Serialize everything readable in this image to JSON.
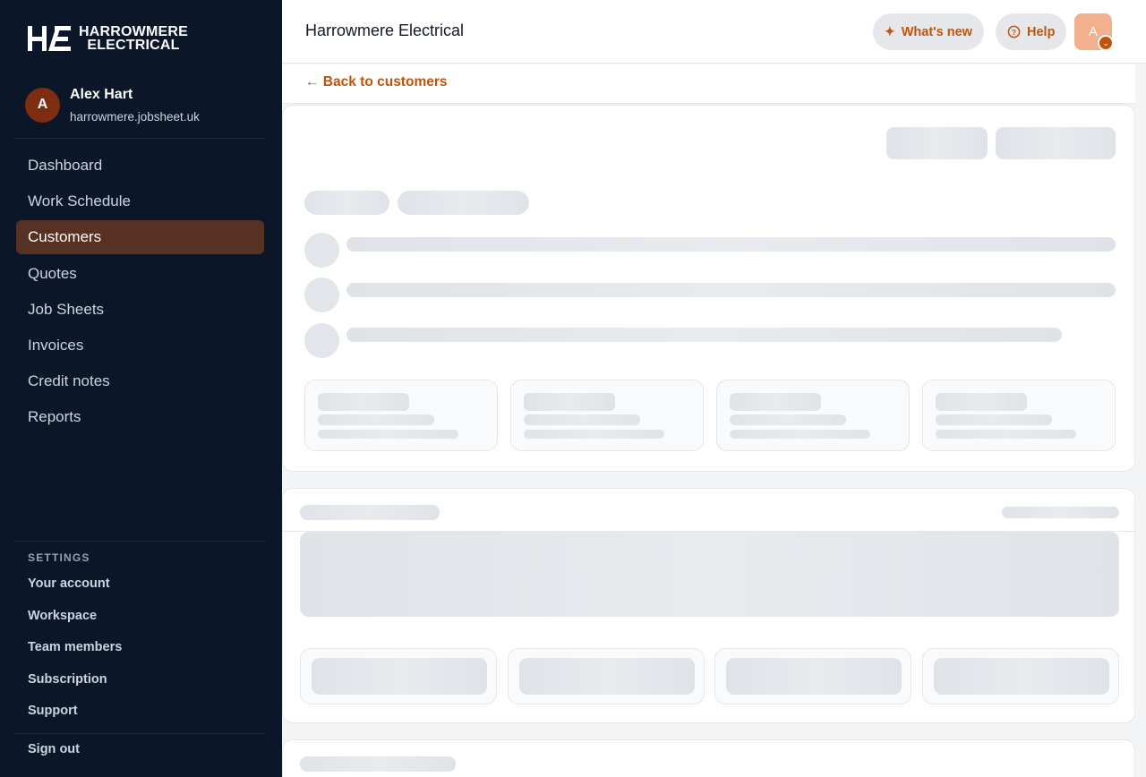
{
  "app": {
    "logo_line1": "HARROWMERE",
    "logo_line2": "ELECTRICAL",
    "title": "Harrowmere Electrical",
    "accent_color": "#c2540a",
    "sidebar_bg": "#0b1628"
  },
  "user": {
    "initial": "A",
    "name": "Alex Hart",
    "domain": "harrowmere.jobsheet.uk"
  },
  "nav": [
    {
      "label": "Dashboard",
      "active": false
    },
    {
      "label": "Work Schedule",
      "active": false
    },
    {
      "label": "Customers",
      "active": true
    },
    {
      "label": "Quotes",
      "active": false
    },
    {
      "label": "Job Sheets",
      "active": false
    },
    {
      "label": "Invoices",
      "active": false
    },
    {
      "label": "Credit notes",
      "active": false
    },
    {
      "label": "Reports",
      "active": false
    }
  ],
  "settings": {
    "heading": "SETTINGS",
    "items": [
      "Your account",
      "Workspace",
      "Team members",
      "Subscription",
      "Support"
    ]
  },
  "signout": "Sign out",
  "header": {
    "whats_new": "What's new",
    "help": "Help",
    "avatar_initial": "A"
  },
  "back_link": "← Back to customers",
  "loading_state": "skeleton"
}
